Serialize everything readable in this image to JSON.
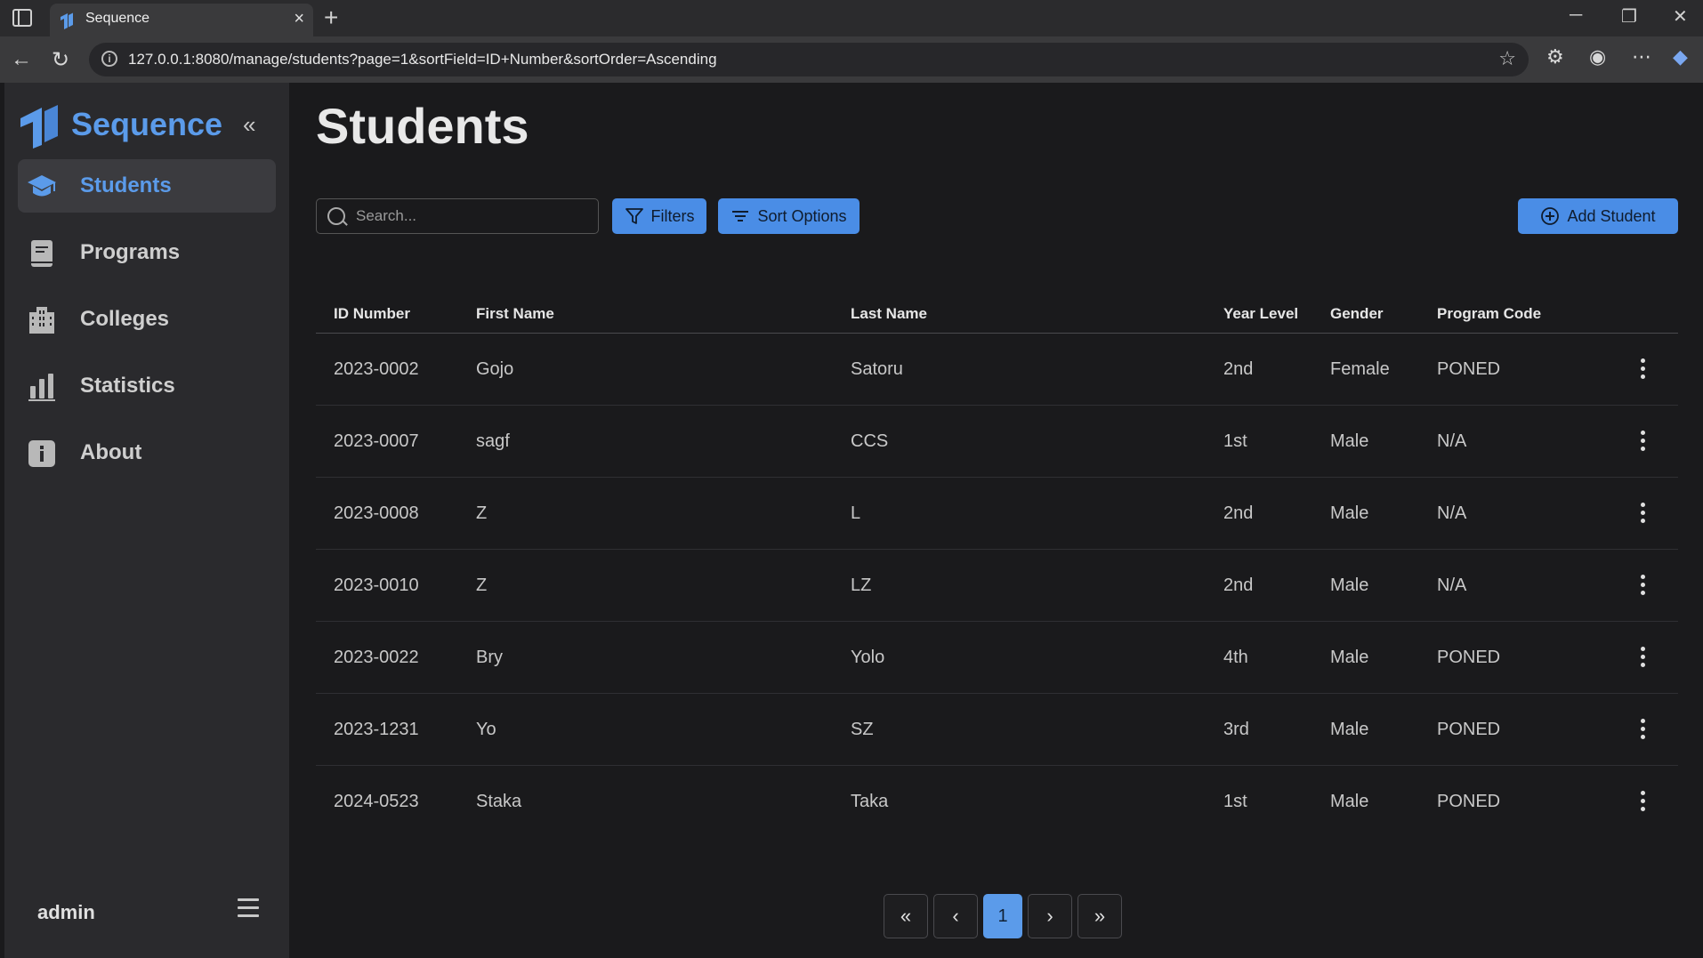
{
  "browser": {
    "tab_title": "Sequence",
    "url": "127.0.0.1:8080/manage/students?page=1&sortField=ID+Number&sortOrder=Ascending"
  },
  "sidebar": {
    "brand": "Sequence",
    "items": [
      {
        "label": "Students",
        "icon": "graduation-cap-icon",
        "active": true
      },
      {
        "label": "Programs",
        "icon": "book-icon",
        "active": false
      },
      {
        "label": "Colleges",
        "icon": "building-icon",
        "active": false
      },
      {
        "label": "Statistics",
        "icon": "bar-chart-icon",
        "active": false
      },
      {
        "label": "About",
        "icon": "info-icon",
        "active": false
      }
    ],
    "user": "admin"
  },
  "main": {
    "title": "Students",
    "search_placeholder": "Search...",
    "filters_label": "Filters",
    "sort_label": "Sort Options",
    "add_label": "Add Student",
    "columns": [
      "ID Number",
      "First Name",
      "Last Name",
      "Year Level",
      "Gender",
      "Program Code"
    ],
    "rows": [
      [
        "2023-0002",
        "Gojo",
        "Satoru",
        "2nd",
        "Female",
        "PONED"
      ],
      [
        "2023-0007",
        "sagf",
        "CCS",
        "1st",
        "Male",
        "N/A"
      ],
      [
        "2023-0008",
        "Z",
        "L",
        "2nd",
        "Male",
        "N/A"
      ],
      [
        "2023-0010",
        "Z",
        "LZ",
        "2nd",
        "Male",
        "N/A"
      ],
      [
        "2023-0022",
        "Bry",
        "Yolo",
        "4th",
        "Male",
        "PONED"
      ],
      [
        "2023-1231",
        "Yo",
        "SZ",
        "3rd",
        "Male",
        "PONED"
      ],
      [
        "2024-0523",
        "Staka",
        "Taka",
        "1st",
        "Male",
        "PONED"
      ]
    ],
    "pagination": {
      "first": "«",
      "prev": "‹",
      "current": "1",
      "next": "›",
      "last": "»"
    }
  },
  "colors": {
    "accent": "#5b9bea",
    "button": "#4a8de6",
    "sidebar_bg": "#2a2a2d",
    "main_bg": "#1a1a1c"
  }
}
